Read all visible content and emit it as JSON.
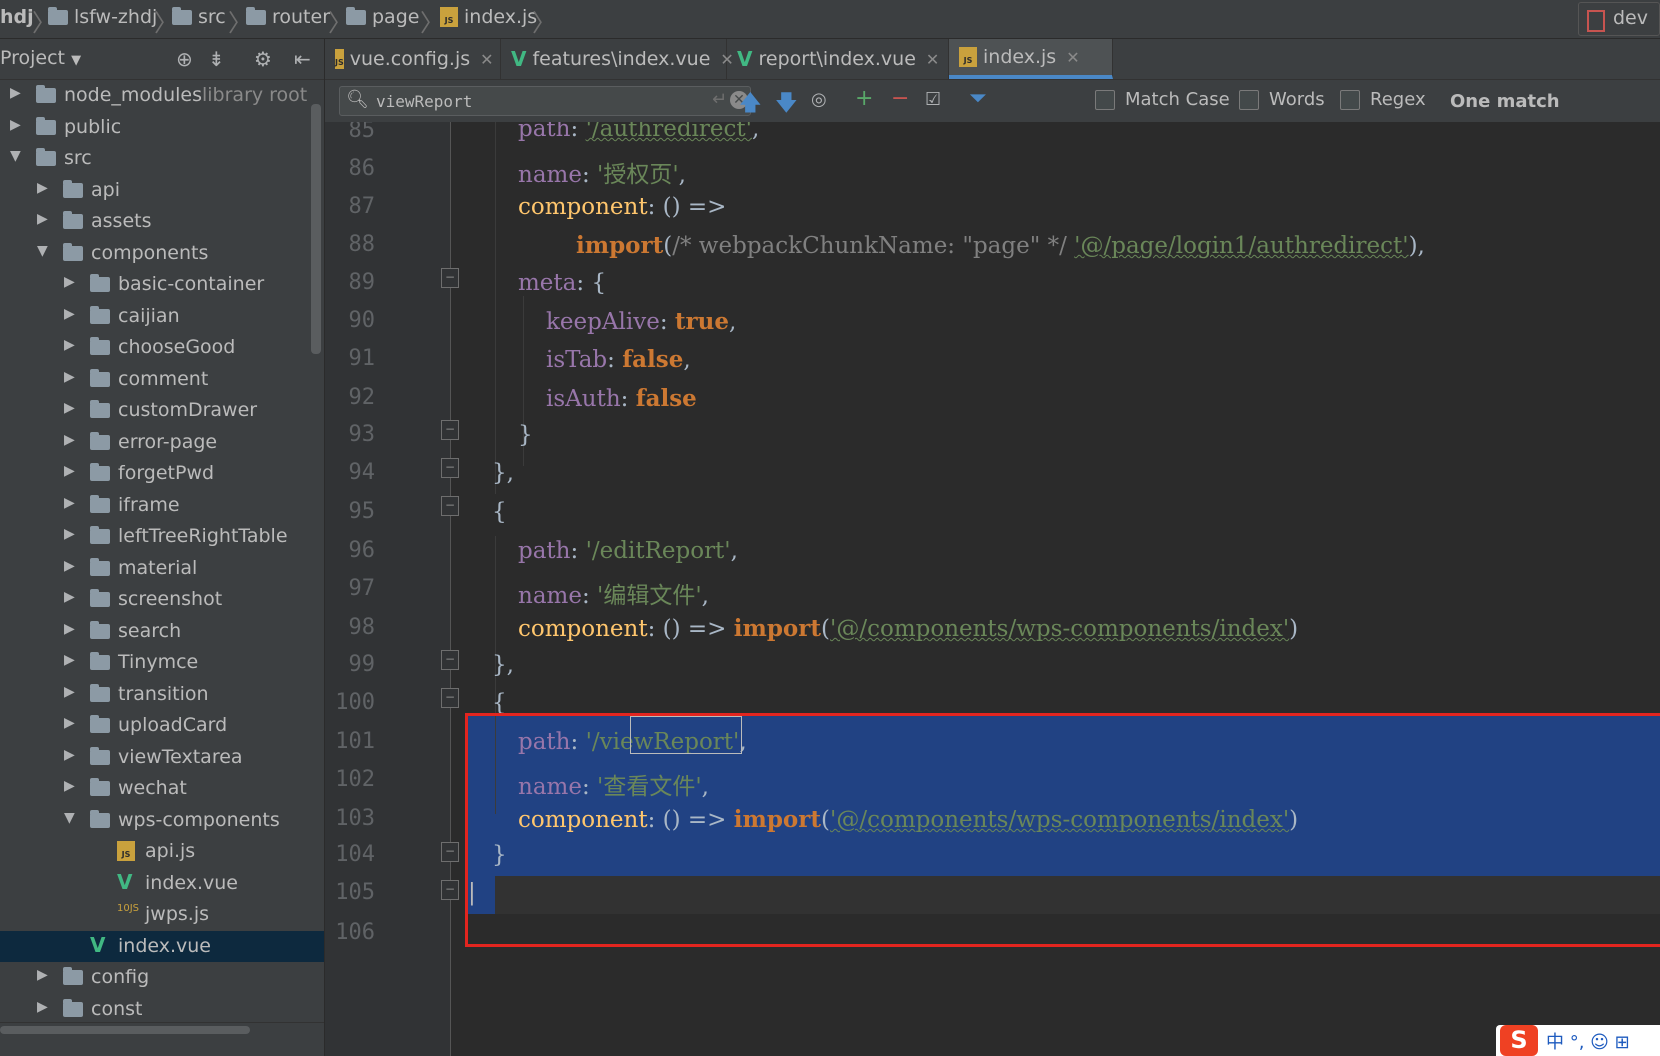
{
  "breadcrumb": [
    {
      "label": "hdj",
      "type": "text"
    },
    {
      "label": "lsfw-zhdj",
      "type": "folder"
    },
    {
      "label": "src",
      "type": "folder"
    },
    {
      "label": "router",
      "type": "folder"
    },
    {
      "label": "page",
      "type": "folder"
    },
    {
      "label": "index.js",
      "type": "js"
    }
  ],
  "branch": "dev",
  "project_panel": {
    "title": "Project",
    "tree": [
      {
        "label": "node_modules",
        "hint": "library root",
        "depth": 0,
        "expanded": false,
        "type": "folder"
      },
      {
        "label": "public",
        "depth": 0,
        "expanded": false,
        "type": "folder"
      },
      {
        "label": "src",
        "depth": 0,
        "expanded": true,
        "type": "folder"
      },
      {
        "label": "api",
        "depth": 1,
        "expanded": false,
        "type": "folder"
      },
      {
        "label": "assets",
        "depth": 1,
        "expanded": false,
        "type": "folder"
      },
      {
        "label": "components",
        "depth": 1,
        "expanded": true,
        "type": "folder"
      },
      {
        "label": "basic-container",
        "depth": 2,
        "expanded": false,
        "type": "folder"
      },
      {
        "label": "caijian",
        "depth": 2,
        "expanded": false,
        "type": "folder"
      },
      {
        "label": "chooseGood",
        "depth": 2,
        "expanded": false,
        "type": "folder"
      },
      {
        "label": "comment",
        "depth": 2,
        "expanded": false,
        "type": "folder"
      },
      {
        "label": "customDrawer",
        "depth": 2,
        "expanded": false,
        "type": "folder"
      },
      {
        "label": "error-page",
        "depth": 2,
        "expanded": false,
        "type": "folder"
      },
      {
        "label": "forgetPwd",
        "depth": 2,
        "expanded": false,
        "type": "folder"
      },
      {
        "label": "iframe",
        "depth": 2,
        "expanded": false,
        "type": "folder"
      },
      {
        "label": "leftTreeRightTable",
        "depth": 2,
        "expanded": false,
        "type": "folder"
      },
      {
        "label": "material",
        "depth": 2,
        "expanded": false,
        "type": "folder"
      },
      {
        "label": "screenshot",
        "depth": 2,
        "expanded": false,
        "type": "folder"
      },
      {
        "label": "search",
        "depth": 2,
        "expanded": false,
        "type": "folder"
      },
      {
        "label": "Tinymce",
        "depth": 2,
        "expanded": false,
        "type": "folder"
      },
      {
        "label": "transition",
        "depth": 2,
        "expanded": false,
        "type": "folder"
      },
      {
        "label": "uploadCard",
        "depth": 2,
        "expanded": false,
        "type": "folder"
      },
      {
        "label": "viewTextarea",
        "depth": 2,
        "expanded": false,
        "type": "folder"
      },
      {
        "label": "wechat",
        "depth": 2,
        "expanded": false,
        "type": "folder"
      },
      {
        "label": "wps-components",
        "depth": 2,
        "expanded": true,
        "type": "folder"
      },
      {
        "label": "api.js",
        "depth": 3,
        "type": "js"
      },
      {
        "label": "index.vue",
        "depth": 3,
        "type": "vue"
      },
      {
        "label": "jwps.js",
        "depth": 3,
        "type": "binjs"
      },
      {
        "label": "index.vue",
        "depth": 2,
        "type": "vue",
        "selected": true
      },
      {
        "label": "config",
        "depth": 1,
        "expanded": false,
        "type": "folder"
      },
      {
        "label": "const",
        "depth": 1,
        "expanded": false,
        "type": "folder"
      }
    ]
  },
  "tabs": [
    {
      "label": "vue.config.js",
      "type": "js",
      "active": false
    },
    {
      "label": "features\\index.vue",
      "type": "vue",
      "active": false
    },
    {
      "label": "report\\index.vue",
      "type": "vue",
      "active": false
    },
    {
      "label": "index.js",
      "type": "js",
      "active": true
    }
  ],
  "find": {
    "query": "viewReport",
    "options": [
      {
        "label": "Match Case",
        "checked": false
      },
      {
        "label": "Words",
        "checked": false
      },
      {
        "label": "Regex",
        "checked": false
      }
    ],
    "result": "One match"
  },
  "editor": {
    "line_numbers": [
      "85",
      "86",
      "87",
      "88",
      "89",
      "90",
      "91",
      "92",
      "93",
      "94",
      "95",
      "96",
      "97",
      "98",
      "99",
      "100",
      "101",
      "102",
      "103",
      "104",
      "105",
      "106"
    ],
    "lines": {
      "l85": {
        "key": "path",
        "str": "'/authredirect'"
      },
      "l86": {
        "key": "name",
        "str": "'授权页'"
      },
      "l87": {
        "key": "component",
        "rest": "() =>"
      },
      "l88": {
        "kw": "import",
        "comment": "/* webpackChunkName: \"page\" */",
        "str": "'@/page/login1/authredirect'"
      },
      "l89": {
        "key": "meta",
        "rest": "{"
      },
      "l90": {
        "key": "keepAlive",
        "val": "true"
      },
      "l91": {
        "key": "isTab",
        "val": "false"
      },
      "l92": {
        "key": "isAuth",
        "val": "false"
      },
      "l96": {
        "key": "path",
        "str": "'/editReport'"
      },
      "l97": {
        "key": "name",
        "str": "'编辑文件'"
      },
      "l98": {
        "key": "component",
        "rest": "() =>",
        "kw": "import",
        "str": "'@/components/wps-components/index'"
      },
      "l101": {
        "key": "path",
        "str_pre": "'/",
        "match": "viewReport",
        "str_post": "'"
      },
      "l102": {
        "key": "name",
        "str": "'查看文件'"
      },
      "l103": {
        "key": "component",
        "rest": "() =>",
        "kw": "import",
        "str": "'@/components/wps-components/index'"
      }
    }
  },
  "ime": {
    "text": "中 °, ☺ ⊞"
  },
  "colors": {
    "highlight_box": "#e3251f",
    "selection": "#214283",
    "keyword": "#cc7832",
    "string": "#6a8759",
    "property": "#9876aa"
  }
}
